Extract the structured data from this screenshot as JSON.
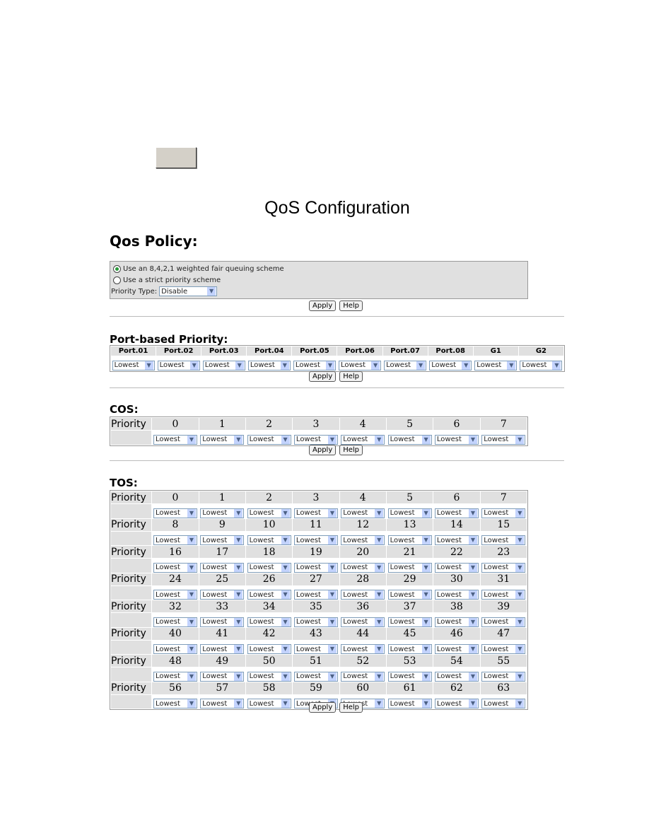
{
  "page_title": "QoS Configuration",
  "policy": {
    "heading": "Qos Policy:",
    "option_wfq": "Use an 8,4,2,1 weighted fair queuing scheme",
    "option_strict": "Use a strict priority scheme",
    "selected": "wfq",
    "priority_type_label": "Priority Type:",
    "priority_type_value": "Disable",
    "apply": "Apply",
    "help": "Help"
  },
  "port_based": {
    "heading": "Port-based Priority:",
    "ports": [
      "Port.01",
      "Port.02",
      "Port.03",
      "Port.04",
      "Port.05",
      "Port.06",
      "Port.07",
      "Port.08",
      "G1",
      "G2"
    ],
    "values": [
      "Lowest",
      "Lowest",
      "Lowest",
      "Lowest",
      "Lowest",
      "Lowest",
      "Lowest",
      "Lowest",
      "Lowest",
      "Lowest"
    ],
    "apply": "Apply",
    "help": "Help"
  },
  "cos": {
    "heading": "COS:",
    "row_label": "Priority",
    "levels": [
      "0",
      "1",
      "2",
      "3",
      "4",
      "5",
      "6",
      "7"
    ],
    "values": [
      "Lowest",
      "Lowest",
      "Lowest",
      "Lowest",
      "Lowest",
      "Lowest",
      "Lowest",
      "Lowest"
    ],
    "apply": "Apply",
    "help": "Help"
  },
  "tos": {
    "heading": "TOS:",
    "row_label": "Priority",
    "rows": [
      {
        "levels": [
          "0",
          "1",
          "2",
          "3",
          "4",
          "5",
          "6",
          "7"
        ],
        "values": [
          "Lowest",
          "Lowest",
          "Lowest",
          "Lowest",
          "Lowest",
          "Lowest",
          "Lowest",
          "Lowest"
        ]
      },
      {
        "levels": [
          "8",
          "9",
          "10",
          "11",
          "12",
          "13",
          "14",
          "15"
        ],
        "values": [
          "Lowest",
          "Lowest",
          "Lowest",
          "Lowest",
          "Lowest",
          "Lowest",
          "Lowest",
          "Lowest"
        ]
      },
      {
        "levels": [
          "16",
          "17",
          "18",
          "19",
          "20",
          "21",
          "22",
          "23"
        ],
        "values": [
          "Lowest",
          "Lowest",
          "Lowest",
          "Lowest",
          "Lowest",
          "Lowest",
          "Lowest",
          "Lowest"
        ]
      },
      {
        "levels": [
          "24",
          "25",
          "26",
          "27",
          "28",
          "29",
          "30",
          "31"
        ],
        "values": [
          "Lowest",
          "Lowest",
          "Lowest",
          "Lowest",
          "Lowest",
          "Lowest",
          "Lowest",
          "Lowest"
        ]
      },
      {
        "levels": [
          "32",
          "33",
          "34",
          "35",
          "36",
          "37",
          "38",
          "39"
        ],
        "values": [
          "Lowest",
          "Lowest",
          "Lowest",
          "Lowest",
          "Lowest",
          "Lowest",
          "Lowest",
          "Lowest"
        ]
      },
      {
        "levels": [
          "40",
          "41",
          "42",
          "43",
          "44",
          "45",
          "46",
          "47"
        ],
        "values": [
          "Lowest",
          "Lowest",
          "Lowest",
          "Lowest",
          "Lowest",
          "Lowest",
          "Lowest",
          "Lowest"
        ]
      },
      {
        "levels": [
          "48",
          "49",
          "50",
          "51",
          "52",
          "53",
          "54",
          "55"
        ],
        "values": [
          "Lowest",
          "Lowest",
          "Lowest",
          "Lowest",
          "Lowest",
          "Lowest",
          "Lowest",
          "Lowest"
        ]
      },
      {
        "levels": [
          "56",
          "57",
          "58",
          "59",
          "60",
          "61",
          "62",
          "63"
        ],
        "values": [
          "Lowest",
          "Lowest",
          "Lowest",
          "Lowest",
          "Lowest",
          "Lowest",
          "Lowest",
          "Lowest"
        ]
      }
    ],
    "apply": "Apply",
    "help": "Help"
  }
}
